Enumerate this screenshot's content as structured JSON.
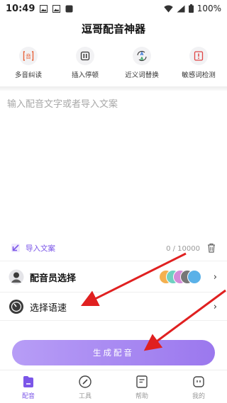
{
  "status_bar": {
    "time": "10:49",
    "battery": "100%",
    "icons": [
      "image-icon",
      "image-icon",
      "notification-icon",
      "wifi-icon",
      "signal-icon",
      "battery-icon"
    ]
  },
  "app_title": "逗哥配音神器",
  "tools": [
    {
      "label": "多音纠读",
      "icon": "pronunciation-icon"
    },
    {
      "label": "插入停顿",
      "icon": "pause-icon"
    },
    {
      "label": "近义词替换",
      "icon": "synonym-swap-icon"
    },
    {
      "label": "敏感词检测",
      "icon": "sensitive-word-icon"
    }
  ],
  "editor": {
    "placeholder": "输入配音文字或者导入文案",
    "value": ""
  },
  "import_label": "导入文案",
  "char_counter": "0 / 10000",
  "voice_row": {
    "label": "配音员选择",
    "icon": "voice-actor-icon"
  },
  "speed_row": {
    "label": "选择语速",
    "icon": "speedometer-icon"
  },
  "generate_label": "生成配音",
  "nav": [
    {
      "label": "配音",
      "icon": "dub-icon",
      "active": true
    },
    {
      "label": "工具",
      "icon": "tools-icon",
      "active": false
    },
    {
      "label": "帮助",
      "icon": "help-icon",
      "active": false
    },
    {
      "label": "我的",
      "icon": "profile-icon",
      "active": false
    }
  ],
  "colors": {
    "accent": "#7b56e8",
    "button_gradient_start": "#b79df6",
    "button_gradient_end": "#9b78ee",
    "annotation_arrow": "#e02020"
  }
}
